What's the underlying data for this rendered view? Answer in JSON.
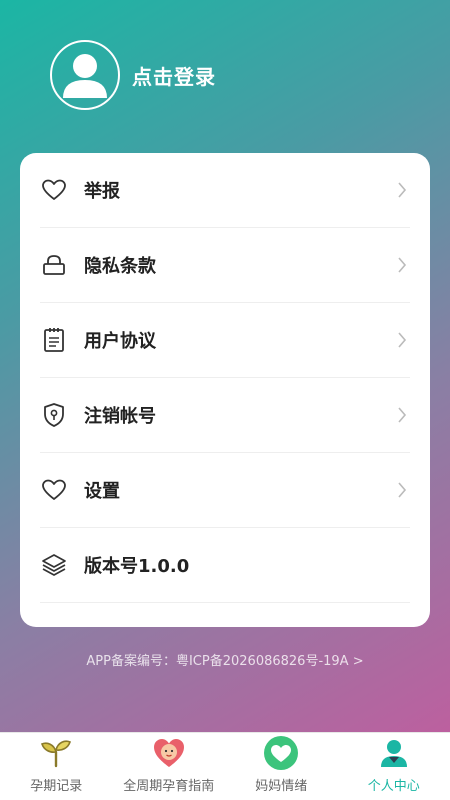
{
  "header": {
    "login_label": "点击登录"
  },
  "menu": {
    "items": [
      {
        "label": "举报",
        "icon": "heart-icon",
        "has_chevron": true
      },
      {
        "label": "隐私条款",
        "icon": "lock-icon",
        "has_chevron": true
      },
      {
        "label": "用户协议",
        "icon": "clipboard-icon",
        "has_chevron": true
      },
      {
        "label": "注销帐号",
        "icon": "shield-icon",
        "has_chevron": true
      },
      {
        "label": "设置",
        "icon": "heart-icon",
        "has_chevron": true
      },
      {
        "label": "版本号1.0.0",
        "icon": "layers-icon",
        "has_chevron": false
      }
    ]
  },
  "footer": {
    "icp_text": "APP备案编号：粤ICP备2026086826号-19A >"
  },
  "tabbar": {
    "tabs": [
      {
        "label": "孕期记录",
        "icon": "sprout-icon",
        "active": false
      },
      {
        "label": "全周期孕育指南",
        "icon": "baby-heart-icon",
        "active": false
      },
      {
        "label": "妈妈情绪",
        "icon": "heart-circle-icon",
        "active": false
      },
      {
        "label": "个人中心",
        "icon": "user-icon",
        "active": true
      }
    ]
  },
  "colors": {
    "accent": "#1bb6a4",
    "gradient_start": "#1bb6a4",
    "gradient_end": "#c65a9e"
  }
}
